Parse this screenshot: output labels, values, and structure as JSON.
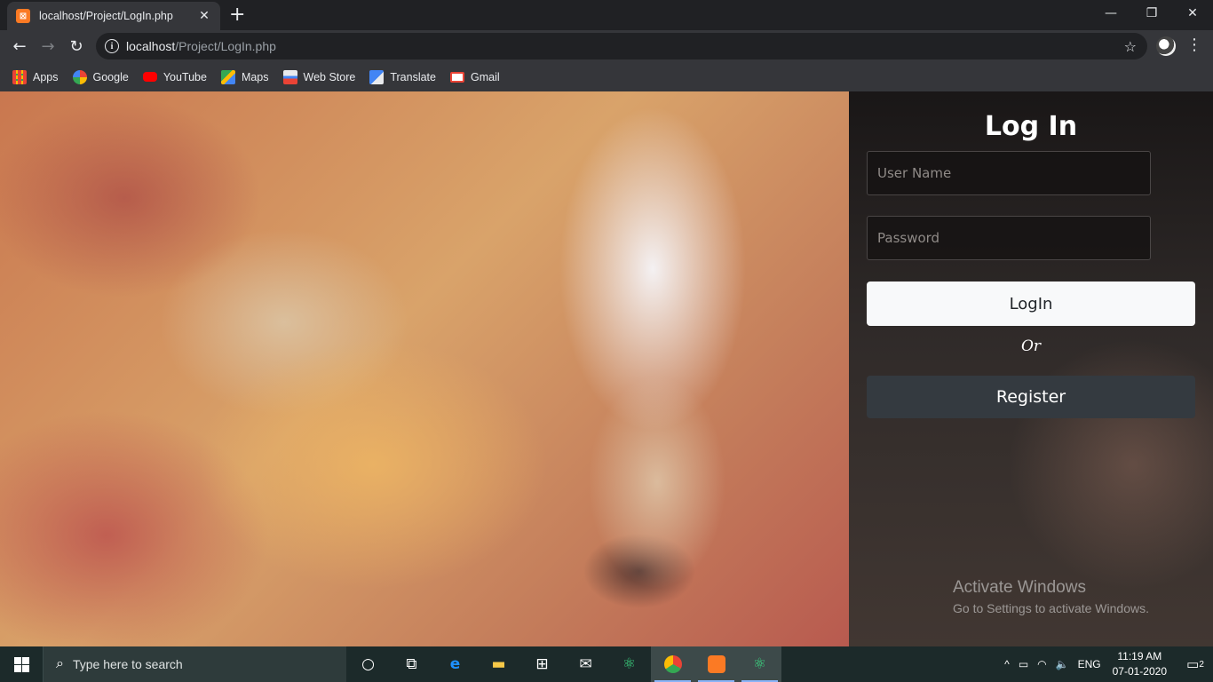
{
  "browser": {
    "tab_title": "localhost/Project/LogIn.php",
    "tab_favicon": "xampp-icon",
    "new_tab_glyph": "+",
    "close_tab_glyph": "✕",
    "address_host": "localhost",
    "address_path": "/Project/LogIn.php",
    "window_controls": {
      "minimize": "—",
      "maximize": "❐",
      "close": "✕"
    }
  },
  "bookmarks": [
    {
      "label": "Apps",
      "icon": "apps-grid-icon",
      "color": "#f4b400"
    },
    {
      "label": "Google",
      "icon": "google-icon",
      "color": "#4285f4"
    },
    {
      "label": "YouTube",
      "icon": "youtube-icon",
      "color": "#ff0000"
    },
    {
      "label": "Maps",
      "icon": "maps-icon",
      "color": "#34a853"
    },
    {
      "label": "Web Store",
      "icon": "web-store-icon",
      "color": "#e8eaed"
    },
    {
      "label": "Translate",
      "icon": "translate-icon",
      "color": "#4285f4"
    },
    {
      "label": "Gmail",
      "icon": "gmail-icon",
      "color": "#ea4335"
    }
  ],
  "login": {
    "title": "Log In",
    "username_placeholder": "User Name",
    "password_placeholder": "Password",
    "login_button": "LogIn",
    "or_text": "Or",
    "register_button": "Register"
  },
  "watermark": {
    "line1": "Activate Windows",
    "line2": "Go to Settings to activate Windows."
  },
  "taskbar": {
    "search_placeholder": "Type here to search",
    "language": "ENG",
    "time": "11:19 AM",
    "date": "07-01-2020",
    "notification_count": "2"
  }
}
